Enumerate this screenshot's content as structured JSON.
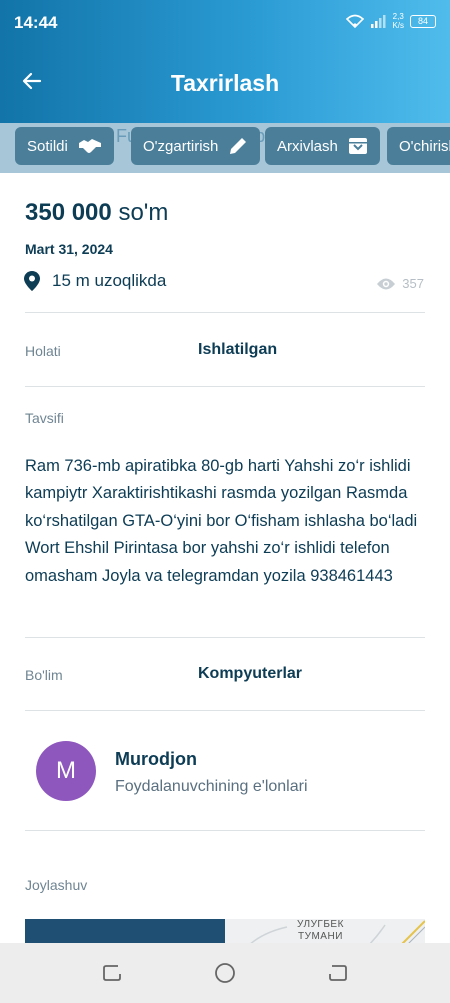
{
  "status_bar": {
    "time": "14:44",
    "speed_value": "2,3",
    "speed_unit": "K/s",
    "battery": "84"
  },
  "header": {
    "title": "Taxrirlash",
    "back_icon": "arrow-left-icon"
  },
  "actions": {
    "background_text": "Kompyuter Fulltec Chrome Spectre",
    "items": [
      {
        "label": "Sotildi",
        "icon": "handshake-icon"
      },
      {
        "label": "O'zgartirish",
        "icon": "pencil-icon"
      },
      {
        "label": "Arxivlash",
        "icon": "archive-icon"
      },
      {
        "label": "O'chirish",
        "icon": "trash-icon"
      }
    ]
  },
  "listing": {
    "price_amount": "350 000",
    "price_currency": "so'm",
    "date": "Mart 31, 2024",
    "distance": "15 m uzoqlikda",
    "views": "357",
    "condition_label": "Holati",
    "condition_value": "Ishlatilgan",
    "description_label": "Tavsifi",
    "description": "Ram 736-mb apiratibka 80-gb harti Yahshi zo‘r ishlidi kampiytr Xaraktirishtikashi rasmda yozilgan Rasmda ko‘rshatilgan GTA-O‘yini bor O‘fisham ishlasha bo‘ladi Wort Ehshil Pirintasa bor yahshi zo‘r ishlidi telefon omasham Joyla va telegramdan yozila 938461443",
    "category_label": "Bo'lim",
    "category_value": "Kompyuterlar"
  },
  "seller": {
    "initial": "M",
    "name": "Murodjon",
    "subtitle": "Foydalanuvchining e'lonlari"
  },
  "location": {
    "label": "Joylashuv",
    "map_text_line1": "УЛУГБЕК",
    "map_text_line2": "ТУМАНИ"
  },
  "colors": {
    "primary": "#0d3c55",
    "header_start": "#1274a8",
    "header_end": "#4fbcec",
    "chip": "#4b7e99",
    "avatar": "#8e57be"
  }
}
